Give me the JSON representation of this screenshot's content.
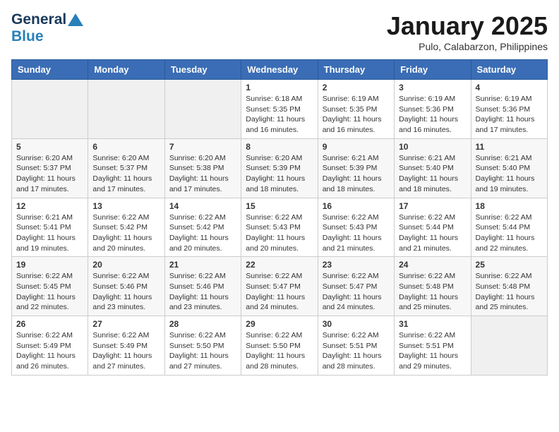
{
  "header": {
    "logo_general": "General",
    "logo_blue": "Blue",
    "month_title": "January 2025",
    "location": "Pulo, Calabarzon, Philippines"
  },
  "weekdays": [
    "Sunday",
    "Monday",
    "Tuesday",
    "Wednesday",
    "Thursday",
    "Friday",
    "Saturday"
  ],
  "weeks": [
    [
      {
        "day": "",
        "sunrise": "",
        "sunset": "",
        "daylight": ""
      },
      {
        "day": "",
        "sunrise": "",
        "sunset": "",
        "daylight": ""
      },
      {
        "day": "",
        "sunrise": "",
        "sunset": "",
        "daylight": ""
      },
      {
        "day": "1",
        "sunrise": "Sunrise: 6:18 AM",
        "sunset": "Sunset: 5:35 PM",
        "daylight": "Daylight: 11 hours and 16 minutes."
      },
      {
        "day": "2",
        "sunrise": "Sunrise: 6:19 AM",
        "sunset": "Sunset: 5:35 PM",
        "daylight": "Daylight: 11 hours and 16 minutes."
      },
      {
        "day": "3",
        "sunrise": "Sunrise: 6:19 AM",
        "sunset": "Sunset: 5:36 PM",
        "daylight": "Daylight: 11 hours and 16 minutes."
      },
      {
        "day": "4",
        "sunrise": "Sunrise: 6:19 AM",
        "sunset": "Sunset: 5:36 PM",
        "daylight": "Daylight: 11 hours and 17 minutes."
      }
    ],
    [
      {
        "day": "5",
        "sunrise": "Sunrise: 6:20 AM",
        "sunset": "Sunset: 5:37 PM",
        "daylight": "Daylight: 11 hours and 17 minutes."
      },
      {
        "day": "6",
        "sunrise": "Sunrise: 6:20 AM",
        "sunset": "Sunset: 5:37 PM",
        "daylight": "Daylight: 11 hours and 17 minutes."
      },
      {
        "day": "7",
        "sunrise": "Sunrise: 6:20 AM",
        "sunset": "Sunset: 5:38 PM",
        "daylight": "Daylight: 11 hours and 17 minutes."
      },
      {
        "day": "8",
        "sunrise": "Sunrise: 6:20 AM",
        "sunset": "Sunset: 5:39 PM",
        "daylight": "Daylight: 11 hours and 18 minutes."
      },
      {
        "day": "9",
        "sunrise": "Sunrise: 6:21 AM",
        "sunset": "Sunset: 5:39 PM",
        "daylight": "Daylight: 11 hours and 18 minutes."
      },
      {
        "day": "10",
        "sunrise": "Sunrise: 6:21 AM",
        "sunset": "Sunset: 5:40 PM",
        "daylight": "Daylight: 11 hours and 18 minutes."
      },
      {
        "day": "11",
        "sunrise": "Sunrise: 6:21 AM",
        "sunset": "Sunset: 5:40 PM",
        "daylight": "Daylight: 11 hours and 19 minutes."
      }
    ],
    [
      {
        "day": "12",
        "sunrise": "Sunrise: 6:21 AM",
        "sunset": "Sunset: 5:41 PM",
        "daylight": "Daylight: 11 hours and 19 minutes."
      },
      {
        "day": "13",
        "sunrise": "Sunrise: 6:22 AM",
        "sunset": "Sunset: 5:42 PM",
        "daylight": "Daylight: 11 hours and 20 minutes."
      },
      {
        "day": "14",
        "sunrise": "Sunrise: 6:22 AM",
        "sunset": "Sunset: 5:42 PM",
        "daylight": "Daylight: 11 hours and 20 minutes."
      },
      {
        "day": "15",
        "sunrise": "Sunrise: 6:22 AM",
        "sunset": "Sunset: 5:43 PM",
        "daylight": "Daylight: 11 hours and 20 minutes."
      },
      {
        "day": "16",
        "sunrise": "Sunrise: 6:22 AM",
        "sunset": "Sunset: 5:43 PM",
        "daylight": "Daylight: 11 hours and 21 minutes."
      },
      {
        "day": "17",
        "sunrise": "Sunrise: 6:22 AM",
        "sunset": "Sunset: 5:44 PM",
        "daylight": "Daylight: 11 hours and 21 minutes."
      },
      {
        "day": "18",
        "sunrise": "Sunrise: 6:22 AM",
        "sunset": "Sunset: 5:44 PM",
        "daylight": "Daylight: 11 hours and 22 minutes."
      }
    ],
    [
      {
        "day": "19",
        "sunrise": "Sunrise: 6:22 AM",
        "sunset": "Sunset: 5:45 PM",
        "daylight": "Daylight: 11 hours and 22 minutes."
      },
      {
        "day": "20",
        "sunrise": "Sunrise: 6:22 AM",
        "sunset": "Sunset: 5:46 PM",
        "daylight": "Daylight: 11 hours and 23 minutes."
      },
      {
        "day": "21",
        "sunrise": "Sunrise: 6:22 AM",
        "sunset": "Sunset: 5:46 PM",
        "daylight": "Daylight: 11 hours and 23 minutes."
      },
      {
        "day": "22",
        "sunrise": "Sunrise: 6:22 AM",
        "sunset": "Sunset: 5:47 PM",
        "daylight": "Daylight: 11 hours and 24 minutes."
      },
      {
        "day": "23",
        "sunrise": "Sunrise: 6:22 AM",
        "sunset": "Sunset: 5:47 PM",
        "daylight": "Daylight: 11 hours and 24 minutes."
      },
      {
        "day": "24",
        "sunrise": "Sunrise: 6:22 AM",
        "sunset": "Sunset: 5:48 PM",
        "daylight": "Daylight: 11 hours and 25 minutes."
      },
      {
        "day": "25",
        "sunrise": "Sunrise: 6:22 AM",
        "sunset": "Sunset: 5:48 PM",
        "daylight": "Daylight: 11 hours and 25 minutes."
      }
    ],
    [
      {
        "day": "26",
        "sunrise": "Sunrise: 6:22 AM",
        "sunset": "Sunset: 5:49 PM",
        "daylight": "Daylight: 11 hours and 26 minutes."
      },
      {
        "day": "27",
        "sunrise": "Sunrise: 6:22 AM",
        "sunset": "Sunset: 5:49 PM",
        "daylight": "Daylight: 11 hours and 27 minutes."
      },
      {
        "day": "28",
        "sunrise": "Sunrise: 6:22 AM",
        "sunset": "Sunset: 5:50 PM",
        "daylight": "Daylight: 11 hours and 27 minutes."
      },
      {
        "day": "29",
        "sunrise": "Sunrise: 6:22 AM",
        "sunset": "Sunset: 5:50 PM",
        "daylight": "Daylight: 11 hours and 28 minutes."
      },
      {
        "day": "30",
        "sunrise": "Sunrise: 6:22 AM",
        "sunset": "Sunset: 5:51 PM",
        "daylight": "Daylight: 11 hours and 28 minutes."
      },
      {
        "day": "31",
        "sunrise": "Sunrise: 6:22 AM",
        "sunset": "Sunset: 5:51 PM",
        "daylight": "Daylight: 11 hours and 29 minutes."
      },
      {
        "day": "",
        "sunrise": "",
        "sunset": "",
        "daylight": ""
      }
    ]
  ]
}
